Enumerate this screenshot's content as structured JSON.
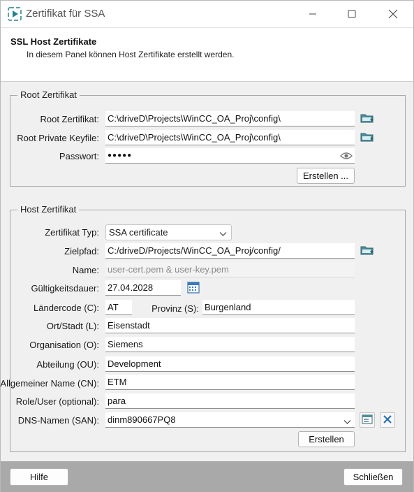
{
  "window": {
    "title": "Zertifikat für SSA",
    "icon": "play-triangle-icon",
    "controls": [
      "minimize-icon",
      "maximize-icon",
      "close-icon"
    ]
  },
  "header": {
    "title": "SSL Host Zertifikate",
    "description": "In diesem Panel können Host Zertifikate erstellt werden."
  },
  "root_group": {
    "title": "Root Zertifikat",
    "root_cert_label": "Root Zertifikat:",
    "root_cert_value": "C:\\driveD\\Projects\\WinCC_OA_Proj\\config\\",
    "root_key_label": "Root Private Keyfile:",
    "root_key_value": "C:\\driveD\\Projects\\WinCC_OA_Proj\\config\\",
    "password_label": "Passwort:",
    "password_value": "●●●●●",
    "create_label": "Erstellen ..."
  },
  "host_group": {
    "title": "Host Zertifikat",
    "type_label": "Zertifikat Typ:",
    "type_value": "SSA certificate",
    "path_label": "Zielpfad:",
    "path_value": "C:/driveD/Projects/WinCC_OA_Proj/config/",
    "name_label": "Name:",
    "name_value": "user-cert.pem & user-key.pem",
    "validity_label": "Gültigkeitsdauer:",
    "validity_value": "27.04.2028",
    "country_label": "Ländercode (C):",
    "country_value": "AT",
    "province_label": "Provinz (S):",
    "province_value": "Burgenland",
    "city_label": "Ort/Stadt (L):",
    "city_value": "Eisenstadt",
    "org_label": "Organisation (O):",
    "org_value": "Siemens",
    "ou_label": "Abteilung (OU):",
    "ou_value": "Development",
    "cn_label": "Allgemeiner Name (CN):",
    "cn_value": "ETM",
    "role_label": "Role/User (optional):",
    "role_value": "para",
    "dns_label": "DNS-Namen (SAN):",
    "dns_value": "dinm890667PQ8",
    "create_label": "Erstellen"
  },
  "footer": {
    "help_label": "Hilfe",
    "close_label": "Schließen"
  },
  "colors": {
    "accent_teal": "#2a7f8f",
    "close_x_blue": "#1f6fb5",
    "footer_gray": "#a9a9a9",
    "calendar_blue": "#3a78b8"
  }
}
